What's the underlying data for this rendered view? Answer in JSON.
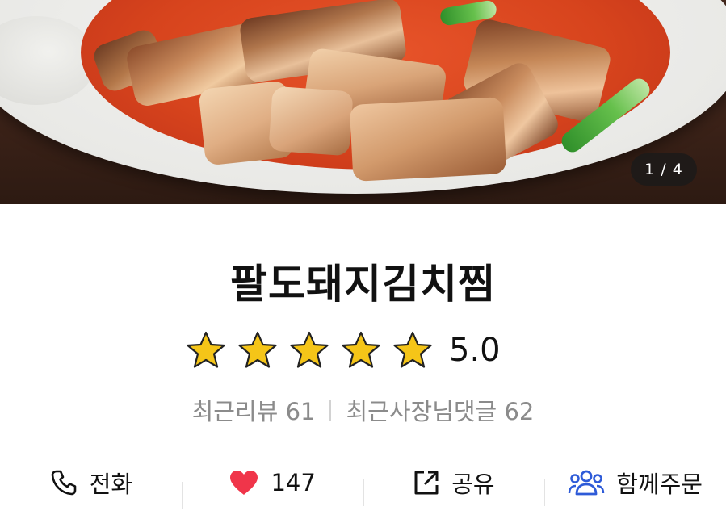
{
  "hero": {
    "image_alt": "Braised kimchi with pork in a white bowl",
    "page_indicator": "1 / 4"
  },
  "title": "팔도돼지김치찜",
  "rating": {
    "stars": 5,
    "score": "5.0"
  },
  "stats": {
    "reviews": "최근리뷰 61",
    "owner_replies": "최근사장님댓글 62"
  },
  "actions": [
    {
      "icon": "phone-icon",
      "label": "전화"
    },
    {
      "icon": "heart-icon",
      "label": "147"
    },
    {
      "icon": "share-icon",
      "label": "공유"
    },
    {
      "icon": "group-icon",
      "label": "함께주문"
    }
  ],
  "colors": {
    "star": "#f5c518",
    "heart": "#f0354a",
    "group_icon": "#2e5bd8"
  }
}
